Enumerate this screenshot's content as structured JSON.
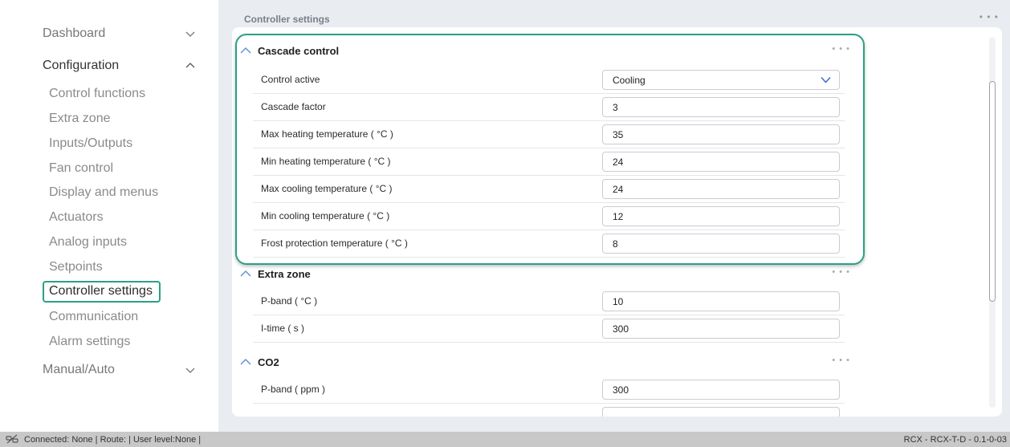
{
  "sidebar": {
    "dashboard": "Dashboard",
    "configuration": "Configuration",
    "items": [
      "Control functions",
      "Extra zone",
      "Inputs/Outputs",
      "Fan control",
      "Display and menus",
      "Actuators",
      "Analog inputs",
      "Setpoints",
      "Controller settings",
      "Communication",
      "Alarm settings"
    ],
    "manual_auto": "Manual/Auto"
  },
  "main": {
    "title": "Controller settings",
    "more": "...",
    "sections": [
      {
        "title": "Cascade control",
        "rows": [
          {
            "label": "Control active",
            "value": "Cooling",
            "type": "select"
          },
          {
            "label": "Cascade factor",
            "value": "3"
          },
          {
            "label": "Max heating temperature ( °C )",
            "value": "35"
          },
          {
            "label": "Min heating temperature ( °C )",
            "value": "24"
          },
          {
            "label": "Max cooling temperature ( °C )",
            "value": "24"
          },
          {
            "label": "Min cooling temperature ( °C )",
            "value": "12"
          },
          {
            "label": "Frost protection temperature ( °C )",
            "value": "8"
          }
        ]
      },
      {
        "title": "Extra zone",
        "rows": [
          {
            "label": "P-band ( °C )",
            "value": "10"
          },
          {
            "label": "I-time ( s )",
            "value": "300"
          }
        ]
      },
      {
        "title": "CO2",
        "rows": [
          {
            "label": "P-band ( ppm )",
            "value": "300"
          }
        ]
      }
    ]
  },
  "statusbar": {
    "left": "Connected: None | Route: | User level:None |",
    "right": "RCX - RCX-T-D - 0.1-0-03"
  },
  "colors": {
    "accent": "#2aa085",
    "main_bg": "#e9ecf0",
    "statusbar_bg": "#c8c8c8"
  }
}
